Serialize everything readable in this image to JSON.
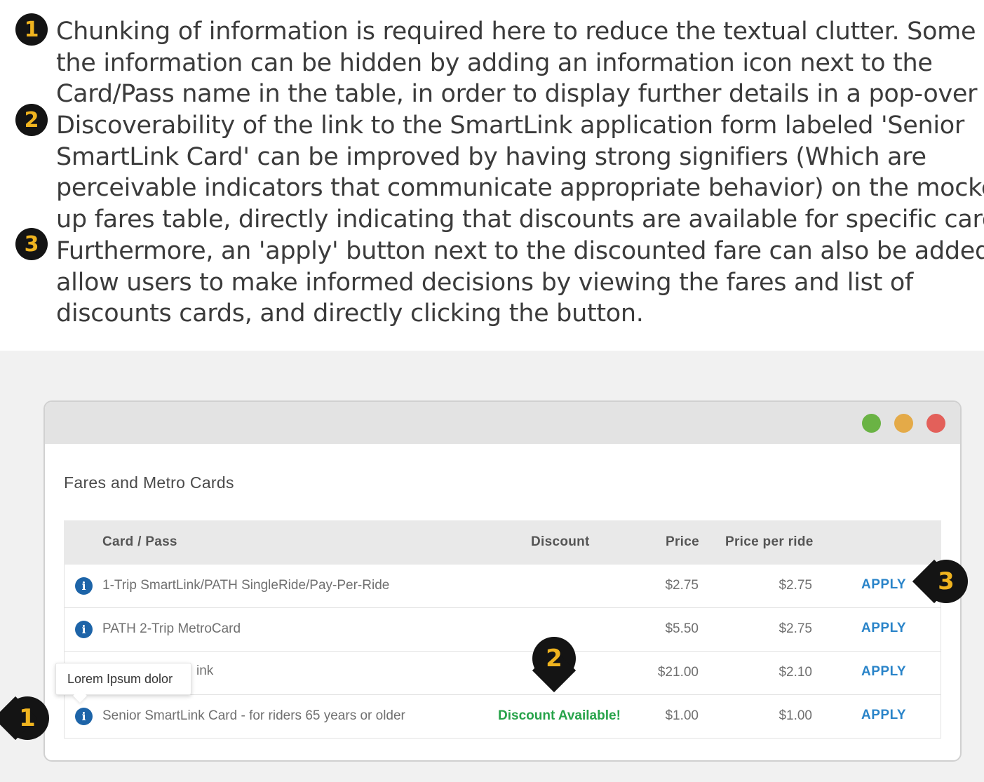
{
  "notes": [
    {
      "number": "1",
      "lines": [
        "Chunking of information is required here to reduce the textual clutter. Some of",
        "the information can be hidden by adding an information icon next to the",
        "Card/Pass name in the table, in order to display further details in a pop-over"
      ]
    },
    {
      "number": "2",
      "lines": [
        "Discoverability of the link to the SmartLink application form labeled 'Senior",
        "SmartLink Card' can be improved by having strong signifiers (Which are",
        "perceivable indicators that communicate appropriate behavior) on the mocked",
        "up fares table, directly indicating that discounts are available for specific cards."
      ]
    },
    {
      "number": "3",
      "lines": [
        "Furthermore, an 'apply' button next to the discounted fare can also be added, to",
        "allow users to make informed decisions by viewing the fares and list of",
        "discounts cards, and directly clicking the button."
      ]
    }
  ],
  "window": {
    "heading": "Fares and Metro Cards",
    "traffic_lights": [
      "#6ab344",
      "#e4aa48",
      "#e3605a"
    ]
  },
  "table": {
    "headers": {
      "card": "Card / Pass",
      "discount": "Discount",
      "price": "Price",
      "per_ride": "Price per ride"
    },
    "rows": [
      {
        "card": "1-Trip SmartLink/PATH SingleRide/Pay-Per-Ride",
        "discount": "",
        "price": "$2.75",
        "per_ride": "$2.75",
        "action": "APPLY"
      },
      {
        "card": "PATH 2-Trip MetroCard",
        "discount": "",
        "price": "$5.50",
        "per_ride": "$2.75",
        "action": "APPLY"
      },
      {
        "card": "ink",
        "discount": "",
        "price": "$21.00",
        "per_ride": "$2.10",
        "action": "APPLY"
      },
      {
        "card": "Senior SmartLink Card - for riders 65 years or older",
        "discount": "Discount Available!",
        "price": "$1.00",
        "per_ride": "$1.00",
        "action": "APPLY"
      }
    ]
  },
  "tooltip": {
    "text": "Lorem Ipsum dolor"
  },
  "callouts": {
    "one": "1",
    "two": "2",
    "three": "3"
  },
  "icons": {
    "info": "i"
  },
  "colors": {
    "callout_bg": "#141414",
    "callout_text": "#f0b41f",
    "discount_green": "#27a34a",
    "apply_blue": "#2a84c9",
    "info_blue": "#1d64a8"
  }
}
